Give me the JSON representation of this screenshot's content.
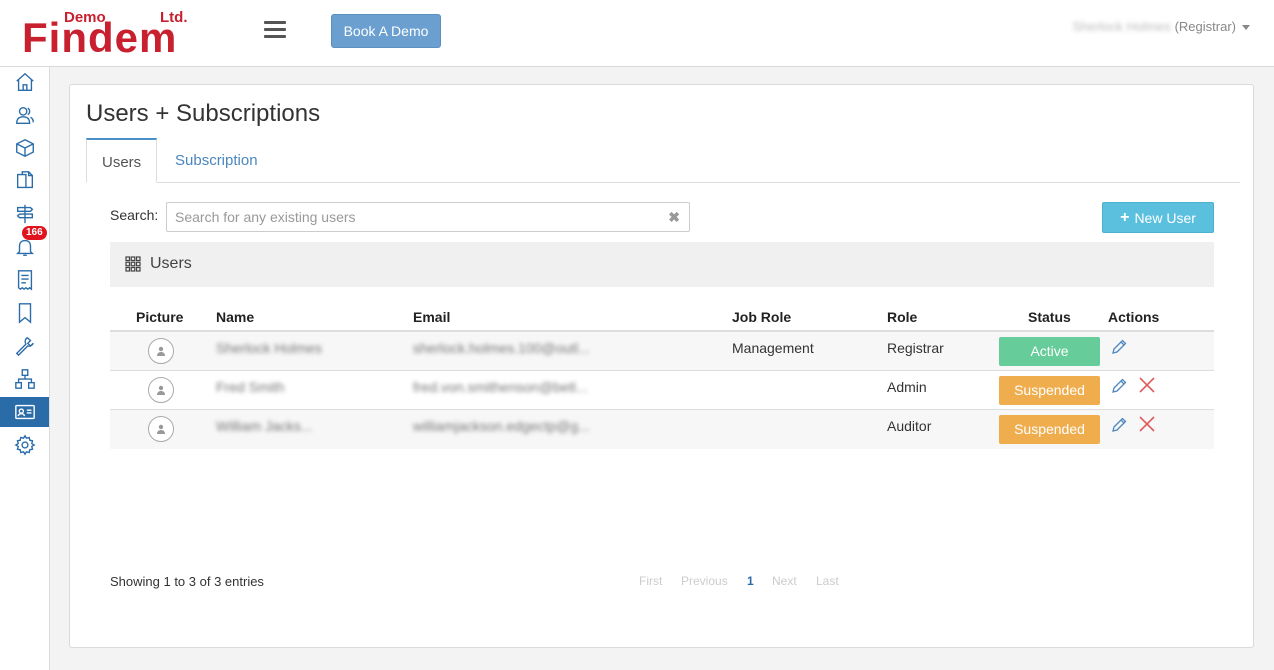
{
  "header": {
    "logo_text": "Findem",
    "logo_demo": "Demo",
    "logo_ltd": "Ltd.",
    "book_demo_label": "Book A Demo",
    "user_name": "Sherlock Holmes",
    "user_role": "(Registrar)"
  },
  "sidebar": {
    "items": [
      {
        "icon": "home-icon"
      },
      {
        "icon": "users-icon"
      },
      {
        "icon": "box-icon"
      },
      {
        "icon": "documents-icon"
      },
      {
        "icon": "signpost-icon"
      },
      {
        "icon": "bell-icon",
        "badge": "166"
      },
      {
        "icon": "receipt-icon"
      },
      {
        "icon": "bookmark-icon"
      },
      {
        "icon": "wrench-icon"
      },
      {
        "icon": "hierarchy-icon"
      },
      {
        "icon": "id-card-icon",
        "active": true
      },
      {
        "icon": "gear-icon"
      }
    ],
    "notification_badge": "166",
    "active_color": "#2a6ca8"
  },
  "page": {
    "title": "Users + Subscriptions",
    "tabs": [
      "Users",
      "Subscription"
    ],
    "search_label": "Search:",
    "search_placeholder": "Search for any existing users",
    "search_clear": "✖",
    "new_user_label": "New User",
    "grid_title": "Users"
  },
  "table": {
    "columns": [
      "Picture",
      "Name",
      "Email",
      "Job Role",
      "Role",
      "Status",
      "Actions"
    ],
    "rows": [
      {
        "name": "Sherlock Holmes",
        "email": "sherlock.holmes.100@outl...",
        "job_role": "Management",
        "role": "Registrar",
        "status": "Active"
      },
      {
        "name": "Fred Smith",
        "email": "fred.von.smithenson@betl...",
        "job_role": "",
        "role": "Admin",
        "status": "Suspended"
      },
      {
        "name": "William Jacks...",
        "email": "williamjackson.edgectp@g...",
        "job_role": "",
        "role": "Auditor",
        "status": "Suspended"
      }
    ]
  },
  "footer": {
    "showing": "Showing 1 to 3 of 3 entries",
    "pager": {
      "first": "First",
      "previous": "Previous",
      "current": "1",
      "next": "Next",
      "last": "Last"
    }
  },
  "colors": {
    "brand_red": "#c8202f",
    "primary": "#6a9fd0",
    "info": "#5bc0de",
    "active_status": "#66cc99",
    "suspended_status": "#f0ad4e",
    "delete": "#e05a5a"
  }
}
